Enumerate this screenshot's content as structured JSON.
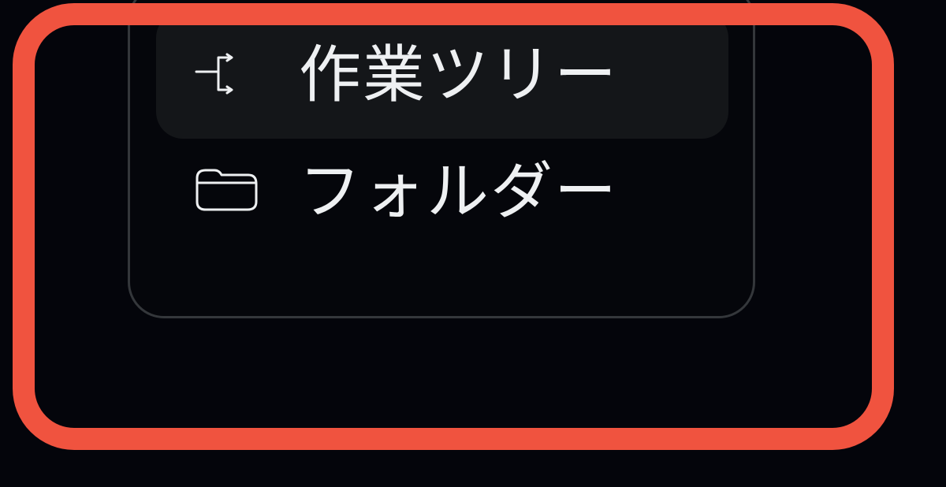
{
  "menu": {
    "items": [
      {
        "label": "作業ツリー",
        "icon": "git-branch-arrow-icon",
        "selected": true
      },
      {
        "label": "フォルダー",
        "icon": "folder-icon",
        "selected": false
      }
    ]
  },
  "colors": {
    "background": "#04050b",
    "highlight_frame": "#f0533f",
    "panel_border": "#34373b",
    "selected_item_background": "#141619",
    "text": "#eef0f2"
  }
}
